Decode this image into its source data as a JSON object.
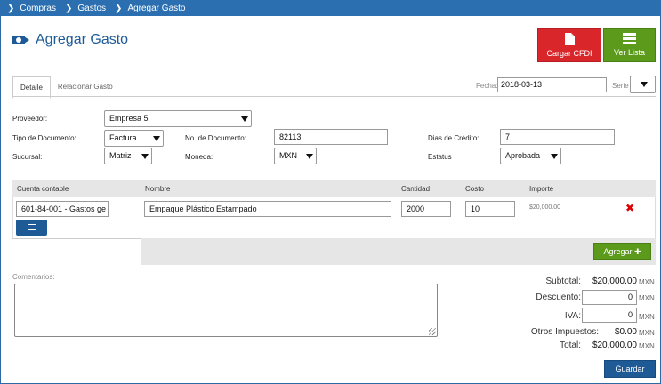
{
  "breadcrumb": {
    "items": [
      "Compras",
      "Gastos",
      "Agregar Gasto"
    ],
    "color": "#2b6fb1"
  },
  "header": {
    "title": "Agregar Gasto",
    "icon": "money-arrow-icon",
    "buttons": {
      "cargar_cfdi": "Cargar CFDI",
      "ver_lista": "Ver Lista"
    }
  },
  "tabs": [
    "Detalle",
    "Relacionar Gasto"
  ],
  "fecha": {
    "label": "Fecha:",
    "value": "2018-03-13"
  },
  "serie": {
    "label": "Serie",
    "value": ""
  },
  "form": {
    "proveedor": {
      "label": "Proveedor:",
      "value": "Empresa 5"
    },
    "tipo_documento": {
      "label": "Tipo de Documento:",
      "value": "Factura"
    },
    "no_documento": {
      "label": "No. de Documento:",
      "value": "82113"
    },
    "dias_credito": {
      "label": "Dias de Crédito:",
      "value": "7"
    },
    "sucursal": {
      "label": "Sucursal:",
      "value": "Matriz"
    },
    "moneda": {
      "label": "Moneda:",
      "value": "MXN"
    },
    "estatus": {
      "label": "Estatus",
      "value": "Aprobada"
    }
  },
  "table": {
    "columns": [
      "Cuenta contable",
      "Nombre",
      "Cantidad",
      "Costo",
      "Importe"
    ],
    "row": {
      "cuenta": "601-84-001 - Gastos ge",
      "nombre": "Empaque Plástico Estampado",
      "cantidad": "2000",
      "costo": "10",
      "importe": "$20,000.00"
    },
    "add_label": "Agregar"
  },
  "comentarios": {
    "label": "Comentarios:",
    "value": ""
  },
  "totals": {
    "subtotal": {
      "label": "Subtotal:",
      "value": "$20,000.00",
      "currency": "MXN"
    },
    "descuento": {
      "label": "Descuento:",
      "value": "0",
      "currency": "MXN"
    },
    "iva": {
      "label": "IVA:",
      "value": "0",
      "currency": "MXN"
    },
    "otros": {
      "label": "Otros Impuestos:",
      "value": "$0.00",
      "currency": "MXN"
    },
    "total": {
      "label": "Total:",
      "value": "$20,000.00",
      "currency": "MXN"
    }
  },
  "guardar_label": "Guardar",
  "colors": {
    "primary": "#1e5a96",
    "danger": "#d9262b",
    "success": "#5b9a1b"
  }
}
